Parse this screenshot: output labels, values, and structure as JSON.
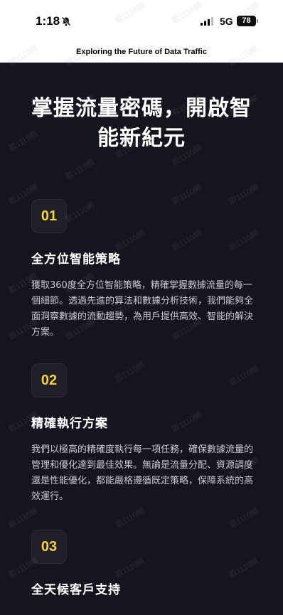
{
  "status_bar": {
    "time": "1:18",
    "network": "5G",
    "battery": "78"
  },
  "header": {
    "title": "Exploring the Future of Data Traffic"
  },
  "hero": {
    "title": "掌握流量密碼，開啟智能新紀元"
  },
  "features": [
    {
      "number": "01",
      "title": "全方位智能策略",
      "description": "獲取360度全方位智能策略，精確掌握數據流量的每一個細節。透過先進的算法和數據分析技術，我們能夠全面洞察數據的流動趨勢，為用戶提供高效、智能的解決方案。"
    },
    {
      "number": "02",
      "title": "精確執行方案",
      "description": "我們以極高的精確度執行每一項任務，確保數據流量的管理和優化達到最佳效果。無論是流量分配、資源調度還是性能優化，都能嚴格遵循既定策略，保障系統的高效運行。"
    },
    {
      "number": "03",
      "title": "全天候客戶支持",
      "description": ""
    }
  ],
  "watermark": "歐1110網",
  "colors": {
    "background": "#151520",
    "accent": "#f5d430"
  }
}
